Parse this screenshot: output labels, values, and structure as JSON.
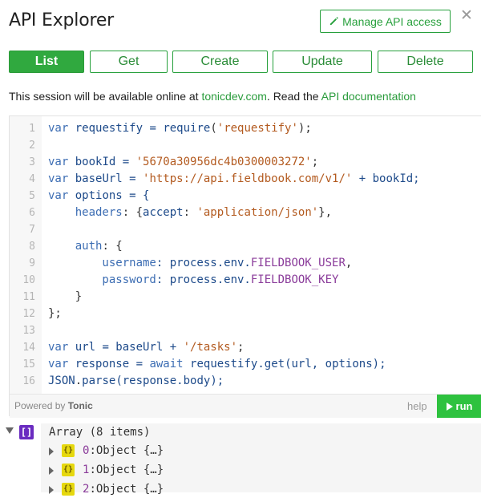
{
  "header": {
    "title": "API Explorer",
    "manage_label": "Manage API access",
    "close_glyph": "✕"
  },
  "tabs": [
    {
      "label": "List",
      "active": true
    },
    {
      "label": "Get",
      "active": false
    },
    {
      "label": "Create",
      "active": false
    },
    {
      "label": "Update",
      "active": false
    },
    {
      "label": "Delete",
      "active": false
    }
  ],
  "info": {
    "prefix": "This session will be available online at ",
    "link1": "tonicdev.com",
    "middle": ". Read the ",
    "link2": "API documentation"
  },
  "editor": {
    "line_numbers": [
      "1",
      "2",
      "3",
      "4",
      "5",
      "6",
      "7",
      "8",
      "9",
      "10",
      "11",
      "12",
      "13",
      "14",
      "15",
      "16"
    ],
    "lines": [
      [
        {
          "t": "var",
          "c": "kw"
        },
        {
          "t": " requestify = ",
          "c": "id"
        },
        {
          "t": "require",
          "c": "fn"
        },
        {
          "t": "(",
          "c": "plain"
        },
        {
          "t": "'requestify'",
          "c": "str"
        },
        {
          "t": ");",
          "c": "plain"
        }
      ],
      [],
      [
        {
          "t": "var",
          "c": "kw"
        },
        {
          "t": " bookId = ",
          "c": "id"
        },
        {
          "t": "'5670a30956dc4b0300003272'",
          "c": "str"
        },
        {
          "t": ";",
          "c": "plain"
        }
      ],
      [
        {
          "t": "var",
          "c": "kw"
        },
        {
          "t": " baseUrl = ",
          "c": "id"
        },
        {
          "t": "'https://api.fieldbook.com/v1/'",
          "c": "str"
        },
        {
          "t": " + bookId;",
          "c": "id"
        }
      ],
      [
        {
          "t": "var",
          "c": "kw"
        },
        {
          "t": " options = {",
          "c": "id"
        }
      ],
      [
        {
          "t": "    headers",
          "c": "prop"
        },
        {
          "t": ": {",
          "c": "plain"
        },
        {
          "t": "accept",
          "c": "id"
        },
        {
          "t": ": ",
          "c": "plain"
        },
        {
          "t": "'application/json'",
          "c": "str"
        },
        {
          "t": "},",
          "c": "plain"
        }
      ],
      [],
      [
        {
          "t": "    auth",
          "c": "prop"
        },
        {
          "t": ": {",
          "c": "plain"
        }
      ],
      [
        {
          "t": "        username",
          "c": "prop"
        },
        {
          "t": ": process.env.",
          "c": "id"
        },
        {
          "t": "FIELDBOOK_USER",
          "c": "cst"
        },
        {
          "t": ",",
          "c": "plain"
        }
      ],
      [
        {
          "t": "        password",
          "c": "prop"
        },
        {
          "t": ": process.env.",
          "c": "id"
        },
        {
          "t": "FIELDBOOK_KEY",
          "c": "cst"
        }
      ],
      [
        {
          "t": "    }",
          "c": "plain"
        }
      ],
      [
        {
          "t": "};",
          "c": "plain"
        }
      ],
      [],
      [
        {
          "t": "var",
          "c": "kw"
        },
        {
          "t": " url = baseUrl + ",
          "c": "id"
        },
        {
          "t": "'/tasks'",
          "c": "str"
        },
        {
          "t": ";",
          "c": "plain"
        }
      ],
      [
        {
          "t": "var",
          "c": "kw"
        },
        {
          "t": " response = ",
          "c": "id"
        },
        {
          "t": "await",
          "c": "kw"
        },
        {
          "t": " requestify.",
          "c": "id"
        },
        {
          "t": "get",
          "c": "fn"
        },
        {
          "t": "(url, options);",
          "c": "id"
        }
      ],
      [
        {
          "t": "JSON",
          "c": "id"
        },
        {
          "t": ".",
          "c": "plain"
        },
        {
          "t": "parse",
          "c": "fn"
        },
        {
          "t": "(response.body);",
          "c": "id"
        }
      ]
    ],
    "powered_prefix": "Powered by ",
    "powered_brand": "Tonic",
    "help_label": "help",
    "run_label": "run"
  },
  "result": {
    "array_icon": "[]",
    "summary": "Array (8 items)",
    "items": [
      {
        "index": "0",
        "text": ":Object {…}"
      },
      {
        "index": "1",
        "text": ":Object {…}"
      },
      {
        "index": "2",
        "text": ":Object {…}"
      }
    ],
    "object_icon": "{}"
  }
}
